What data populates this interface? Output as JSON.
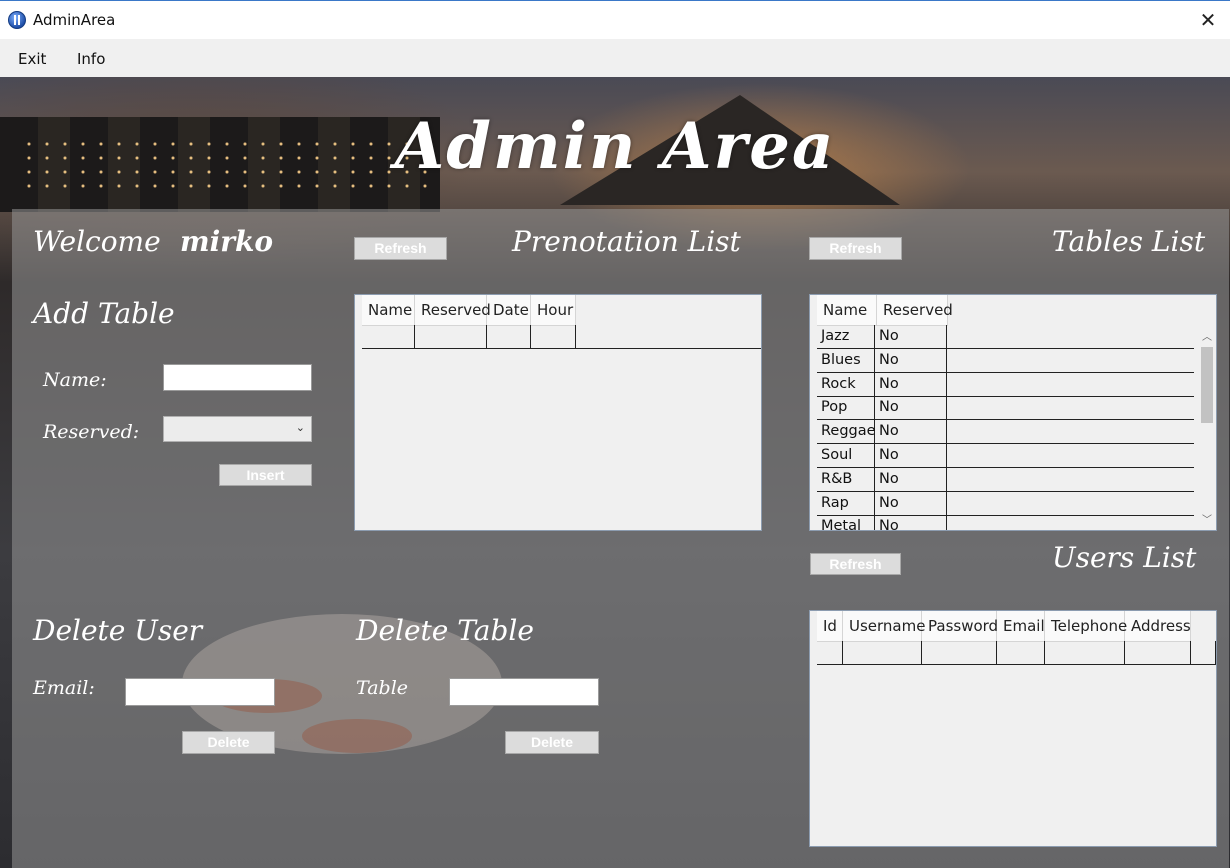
{
  "window": {
    "title": "AdminArea",
    "close_glyph": "✕",
    "icon": "app-icon"
  },
  "menu": {
    "exit": "Exit",
    "info": "Info"
  },
  "banner": "Admin Area",
  "welcome": {
    "label": "Welcome",
    "username": "mirko"
  },
  "add_table": {
    "heading": "Add Table",
    "name_label": "Name:",
    "name_value": "",
    "reserved_label": "Reserved:",
    "reserved_value": "",
    "insert_button": "Insert"
  },
  "prenotation": {
    "heading": "Prenotation List",
    "refresh_button": "Refresh",
    "columns": [
      "Name",
      "Reserved",
      "Date",
      "Hour"
    ]
  },
  "tables": {
    "heading": "Tables List",
    "refresh_button": "Refresh",
    "columns": [
      "Name",
      "Reserved"
    ],
    "rows": [
      {
        "name": "Jazz",
        "reserved": "No"
      },
      {
        "name": "Blues",
        "reserved": "No"
      },
      {
        "name": "Rock",
        "reserved": "No"
      },
      {
        "name": "Pop",
        "reserved": "No"
      },
      {
        "name": "Reggae",
        "reserved": "No"
      },
      {
        "name": "Soul",
        "reserved": "No"
      },
      {
        "name": "R&B",
        "reserved": "No"
      },
      {
        "name": "Rap",
        "reserved": "No"
      },
      {
        "name": "Metal",
        "reserved": "No"
      }
    ]
  },
  "users": {
    "heading": "Users List",
    "refresh_button": "Refresh",
    "columns": [
      "Id",
      "Username",
      "Password",
      "Email",
      "Telephone",
      "Address"
    ]
  },
  "delete_user": {
    "heading": "Delete User",
    "email_label": "Email:",
    "email_value": "",
    "delete_button": "Delete"
  },
  "delete_table": {
    "heading": "Delete Table",
    "table_label": "Table",
    "table_value": "",
    "delete_button": "Delete"
  }
}
